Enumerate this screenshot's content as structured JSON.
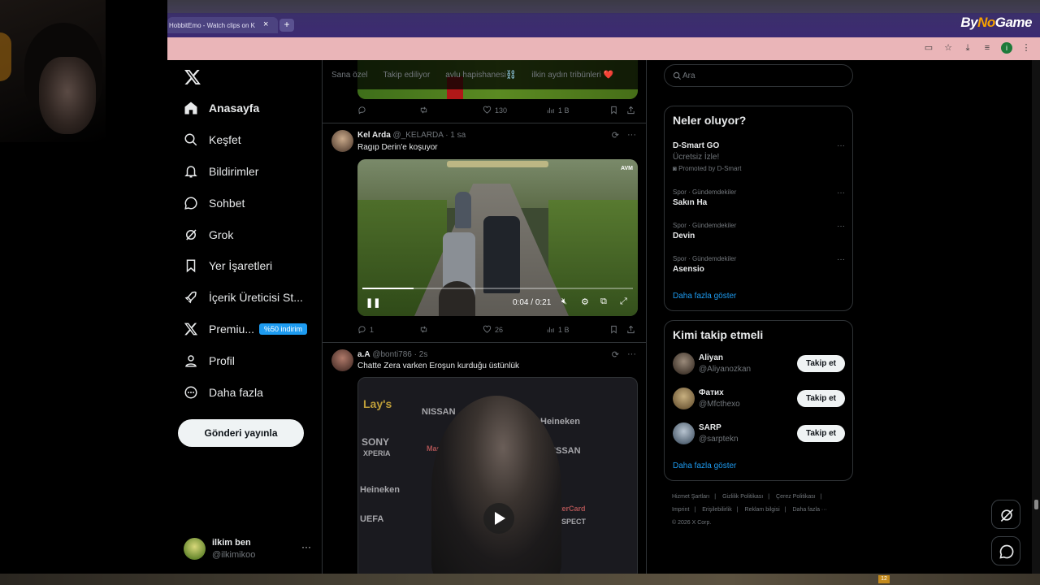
{
  "browser": {
    "tab_title": "HobbitEmo - Watch clips on K",
    "overlay_logo_a": "By",
    "overlay_logo_b": "No",
    "overlay_logo_c": "Game"
  },
  "nav": {
    "items": [
      {
        "label": "Anasayfa",
        "icon": "home-icon"
      },
      {
        "label": "Keşfet",
        "icon": "search-icon"
      },
      {
        "label": "Bildirimler",
        "icon": "bell-icon"
      },
      {
        "label": "Sohbet",
        "icon": "chat-icon"
      },
      {
        "label": "Grok",
        "icon": "grok-icon"
      },
      {
        "label": "Yer İşaretleri",
        "icon": "bookmark-icon"
      },
      {
        "label": "İçerik Üreticisi St...",
        "icon": "rocket-icon"
      },
      {
        "label": "Premiu...",
        "icon": "x-icon",
        "badge": "%50 indirim"
      },
      {
        "label": "Profil",
        "icon": "person-icon"
      },
      {
        "label": "Daha fazla",
        "icon": "more-circle-icon"
      }
    ],
    "post_button": "Gönderi yayınla",
    "account": {
      "name": "ilkim ben",
      "handle": "@ilkimikoo"
    }
  },
  "feed": {
    "tabs": [
      "Sana özel",
      "Takip ediliyor",
      "avlu hapishanesi⛓️",
      "ilkin aydın tribünleri ❤️"
    ],
    "prev_tweet_actions": {
      "replies": "",
      "likes": "130",
      "views": "1 B"
    },
    "tweets": [
      {
        "name": "Kel Arda",
        "handle": "@_KELARDA",
        "time": "· 1 sa",
        "text": "Ragıp Derin'e koşuyor",
        "video": {
          "current": "0:04",
          "total": "0:21",
          "progress": 0.19,
          "brand": "AVM"
        },
        "actions": {
          "replies": "1",
          "likes": "26",
          "views": "1 B"
        }
      },
      {
        "name": "a.A",
        "handle": "@bonti786",
        "time": "· 2s",
        "text": "Chatte Zera varken Eroşun  kurduğu üstünlük",
        "sponsors": [
          "Lay's",
          "NISSAN",
          "Heineken",
          "SONY",
          "XPERIA",
          "MasterCard",
          "NISSAN",
          "Heineken",
          "MasterCard",
          "UEFA",
          "SPECT"
        ]
      }
    ]
  },
  "sidebar": {
    "search_placeholder": "Ara",
    "trends_title": "Neler oluyor?",
    "promo": {
      "name": "D-Smart GO",
      "sub": "Ücretsiz İzle!",
      "by": "Promoted by D-Smart"
    },
    "trends": [
      {
        "category": "Spor · Gündemdekiler",
        "name": "Sakın Ha"
      },
      {
        "category": "Spor · Gündemdekiler",
        "name": "Devin"
      },
      {
        "category": "Spor · Gündemdekiler",
        "name": "Asensio"
      }
    ],
    "show_more": "Daha fazla göster",
    "follow_title": "Kimi takip etmeli",
    "follow": [
      {
        "name": "Aliyan",
        "handle": "@Aliyanozkan",
        "button": "Takip et"
      },
      {
        "name": "Фатих",
        "handle": "@Mfcthexo",
        "button": "Takip et"
      },
      {
        "name": "SARP",
        "handle": "@sarptekn",
        "button": "Takip et"
      }
    ],
    "footer": [
      "Hizmet Şartları",
      "|",
      "Gizlilik Politikası",
      "|",
      "Çerez Politikası",
      "|",
      "Imprint",
      "|",
      "Erişilebilirlik",
      "|",
      "Reklam bilgisi",
      "|",
      "Daha fazla ···",
      "© 2026 X Corp."
    ]
  },
  "taskbar": {
    "badge": "12"
  },
  "colors": {
    "accent": "#1d9bf0",
    "background": "#000000",
    "muted": "#71767b",
    "address_bar": "#eab5b8"
  }
}
